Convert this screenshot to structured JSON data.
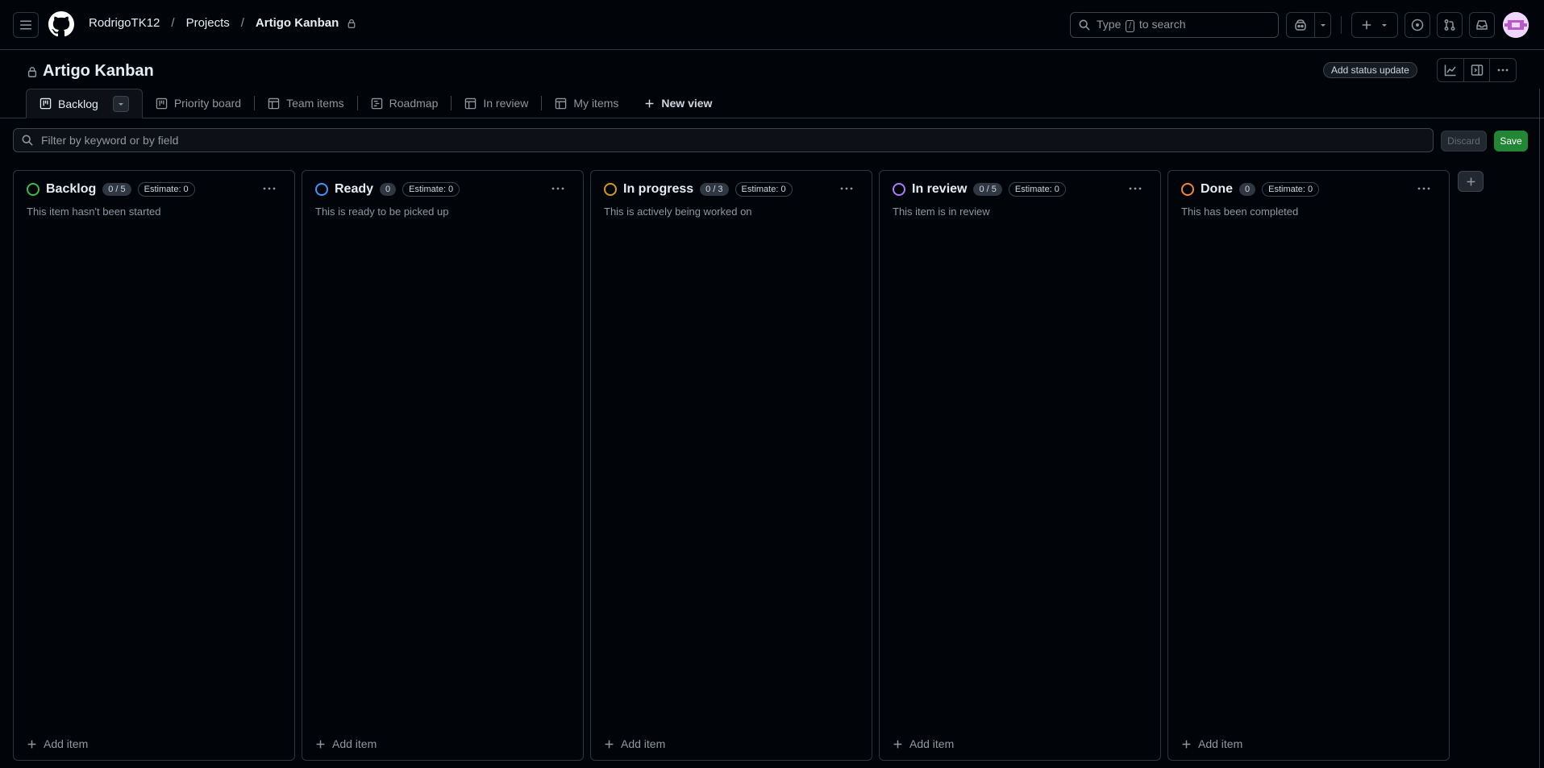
{
  "header": {
    "breadcrumb": [
      "RodrigoTK12",
      "Projects",
      "Artigo Kanban"
    ],
    "search_prefix": "Type",
    "search_key": "/",
    "search_suffix": "to search"
  },
  "project": {
    "title": "Artigo Kanban",
    "status_update_label": "Add status update"
  },
  "tabs": [
    {
      "label": "Backlog",
      "icon": "board-icon"
    },
    {
      "label": "Priority board",
      "icon": "board-icon"
    },
    {
      "label": "Team items",
      "icon": "table-icon"
    },
    {
      "label": "Roadmap",
      "icon": "roadmap-icon"
    },
    {
      "label": "In review",
      "icon": "table-icon"
    },
    {
      "label": "My items",
      "icon": "table-icon"
    },
    {
      "label": "New view",
      "icon": "plus-icon"
    }
  ],
  "filter": {
    "placeholder": "Filter by keyword or by field",
    "discard_label": "Discard",
    "save_label": "Save"
  },
  "columns": [
    {
      "name": "Backlog",
      "count": "0 / 5",
      "estimate": "Estimate: 0",
      "description": "This item hasn't been started",
      "color": "#3fb950",
      "add_label": "Add item"
    },
    {
      "name": "Ready",
      "count": "0",
      "estimate": "Estimate: 0",
      "description": "This is ready to be picked up",
      "color": "#4493f8",
      "add_label": "Add item"
    },
    {
      "name": "In progress",
      "count": "0 / 3",
      "estimate": "Estimate: 0",
      "description": "This is actively being worked on",
      "color": "#d29922",
      "add_label": "Add item"
    },
    {
      "name": "In review",
      "count": "0 / 5",
      "estimate": "Estimate: 0",
      "description": "This item is in review",
      "color": "#ab7df8",
      "add_label": "Add item"
    },
    {
      "name": "Done",
      "count": "0",
      "estimate": "Estimate: 0",
      "description": "This has been completed",
      "color": "#f0883e",
      "add_label": "Add item"
    }
  ]
}
